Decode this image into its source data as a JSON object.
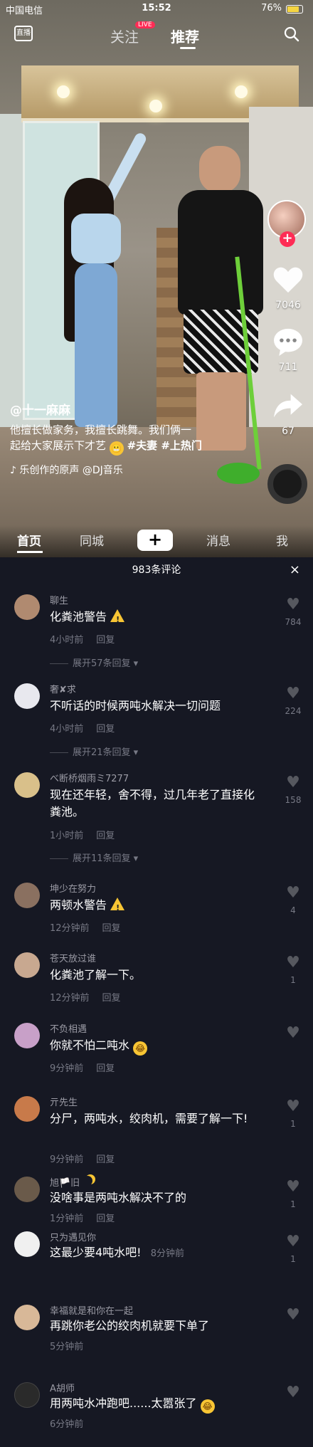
{
  "status": {
    "carrier": "中国电信",
    "time": "15:52",
    "battery": "76%"
  },
  "topnav": {
    "live_icon": "直播",
    "follow": "关注",
    "live_badge": "LIVE",
    "recommend": "推荐"
  },
  "video": {
    "author": "@十一麻麻",
    "description_1": "他擅长做家务，我擅长跳舞。我们俩一",
    "description_2": "起给大家展示下才艺",
    "tags": "#夫妻 #上热门",
    "music": "♪ 乐创作的原声 @DJ音乐"
  },
  "rail": {
    "likes": "7046",
    "comments": "711",
    "shares": "67"
  },
  "tabs": {
    "home": "首页",
    "city": "同城",
    "plus": "+",
    "messages": "消息",
    "me": "我"
  },
  "comments_panel": {
    "header": "983条评论",
    "close": "×",
    "items": [
      {
        "name": "聊生",
        "text": "化粪池警告",
        "time": "4小时前",
        "reply": "回复",
        "likes": "784",
        "expand": "展开57条回复",
        "avatar_color": "#b08a70"
      },
      {
        "name": "奢✘求",
        "text": "不听话的时候两吨水解决一切问题",
        "time": "4小时前",
        "reply": "回复",
        "likes": "224",
        "expand": "展开21条回复",
        "avatar_color": "#e8e8ee"
      },
      {
        "name": "べ断桥烟雨ミ7277",
        "text": "现在还年轻，舍不得，过几年老了直接化粪池。",
        "time": "1小时前",
        "reply": "回复",
        "likes": "158",
        "expand": "展开11条回复",
        "avatar_color": "#d9c08a"
      },
      {
        "name": "坤少在努力",
        "text": "两顿水警告",
        "time": "12分钟前",
        "reply": "回复",
        "likes": "4",
        "avatar_color": "#8a7060"
      },
      {
        "name": "苍天放过谁",
        "text": "化粪池了解一下。",
        "time": "12分钟前",
        "reply": "回复",
        "likes": "1",
        "avatar_color": "#c8a890"
      },
      {
        "name": "不负相遇",
        "text": "你就不怕二吨水",
        "time": "9分钟前",
        "reply": "回复",
        "likes": "",
        "avatar_color": "#c8a0c8"
      },
      {
        "name": "亓先生",
        "text": "分尸，两吨水，绞肉机，需要了解一下!",
        "time": "9分钟前",
        "reply": "回复",
        "likes": "1",
        "avatar_color": "#c87a4a"
      },
      {
        "name": "旭🏳️旧",
        "text": "没啥事是两吨水解决不了的",
        "time": "1分钟前",
        "reply": "回复",
        "likes": "1",
        "avatar_color": "#6a5a4a"
      },
      {
        "name": "只为遇见你",
        "text": "这最少要4吨水吧!",
        "time": "8分钟前",
        "reply": "",
        "likes": "1",
        "avatar_color": "#f0f0f0"
      },
      {
        "name": "幸福就是和你在一起",
        "text": "再跳你老公的绞肉机就要下单了",
        "time": "5分钟前",
        "reply": "",
        "likes": "",
        "avatar_color": "#d8b898"
      },
      {
        "name": "A胡师",
        "text": "用两吨水冲跑吧......太嚣张了",
        "time": "6分钟前",
        "reply": "",
        "likes": "",
        "avatar_color": "#2a2a2a"
      }
    ]
  }
}
